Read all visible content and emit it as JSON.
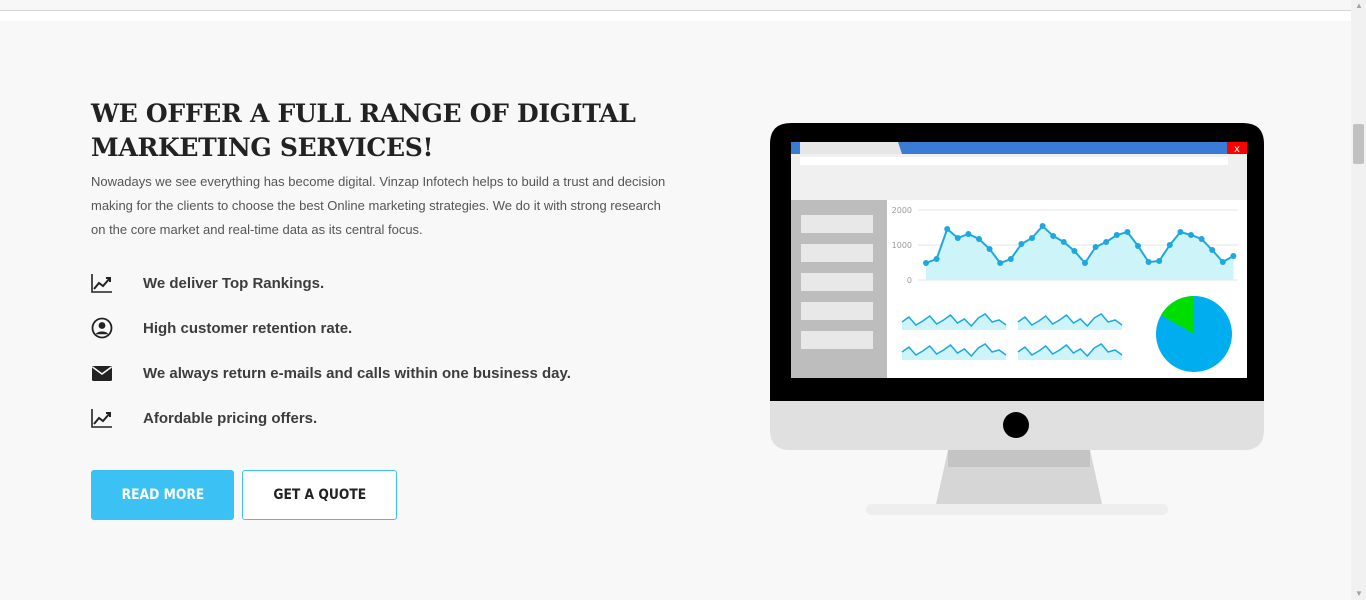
{
  "section": {
    "title": "WE OFFER A FULL RANGE OF DIGITAL MARKETING SERVICES!",
    "description": "Nowadays we see everything has become digital. Vinzap Infotech helps to build a trust and decision making for the clients to choose the best Online marketing strategies. We do it with strong research on the core market and real-time data as its central focus."
  },
  "features": [
    {
      "icon": "trending-up-icon",
      "label": "We deliver Top Rankings."
    },
    {
      "icon": "user-circle-icon",
      "label": "High customer retention rate."
    },
    {
      "icon": "envelope-icon",
      "label": "We always return e-mails and calls within one business day."
    },
    {
      "icon": "trending-up-icon",
      "label": "Afordable pricing offers."
    }
  ],
  "buttons": {
    "read_more": "READ MORE",
    "get_quote": "GET A QUOTE"
  },
  "illustration": {
    "window_close_glyph": "x",
    "chart_y_ticks": [
      "2000",
      "1000",
      "0"
    ]
  },
  "colors": {
    "accent": "#3cc1f5",
    "chart_line": "#1fa8e0",
    "pie_main": "#00aeef",
    "pie_slice": "#00dd00",
    "close_button": "#ff0000"
  }
}
